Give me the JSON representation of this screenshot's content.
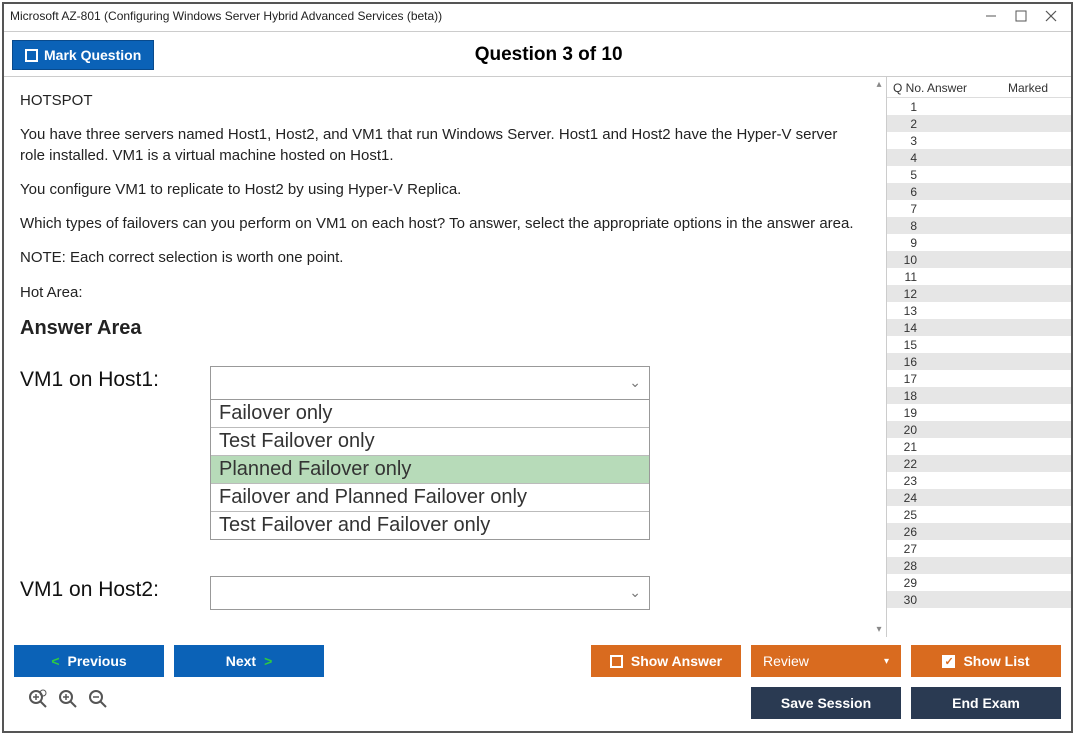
{
  "window": {
    "title": "Microsoft AZ-801 (Configuring Windows Server Hybrid Advanced Services (beta))"
  },
  "header": {
    "mark_label": "Mark Question",
    "question_counter": "Question 3 of 10"
  },
  "question": {
    "tag": "HOTSPOT",
    "para1": "You have three servers named Host1, Host2, and VM1 that run Windows Server. Host1 and Host2 have the Hyper-V server role installed. VM1 is a virtual machine hosted on Host1.",
    "para2": "You configure VM1 to replicate to Host2 by using Hyper-V Replica.",
    "para3": "Which types of failovers can you perform on VM1 on each host? To answer, select the appropriate options in the answer area.",
    "note": "NOTE: Each correct selection is worth one point.",
    "hot_area_label": "Hot Area:",
    "answer_area_heading": "Answer Area",
    "rows": [
      {
        "label": "VM1 on Host1:",
        "expanded": true,
        "selected_index": 2,
        "options": [
          "Failover only",
          "Test Failover only",
          "Planned Failover only",
          "Failover and Planned Failover only",
          "Test Failover and Failover only"
        ]
      },
      {
        "label": "VM1 on Host2:",
        "expanded": false,
        "selected_index": null,
        "options": []
      }
    ]
  },
  "sidebar": {
    "col_qno": "Q No.",
    "col_answer": "Answer",
    "col_marked": "Marked",
    "rows": [
      1,
      2,
      3,
      4,
      5,
      6,
      7,
      8,
      9,
      10,
      11,
      12,
      13,
      14,
      15,
      16,
      17,
      18,
      19,
      20,
      21,
      22,
      23,
      24,
      25,
      26,
      27,
      28,
      29,
      30
    ]
  },
  "footer": {
    "previous": "Previous",
    "next": "Next",
    "show_answer": "Show Answer",
    "review": "Review",
    "show_list": "Show List",
    "save_session": "Save Session",
    "end_exam": "End Exam"
  }
}
